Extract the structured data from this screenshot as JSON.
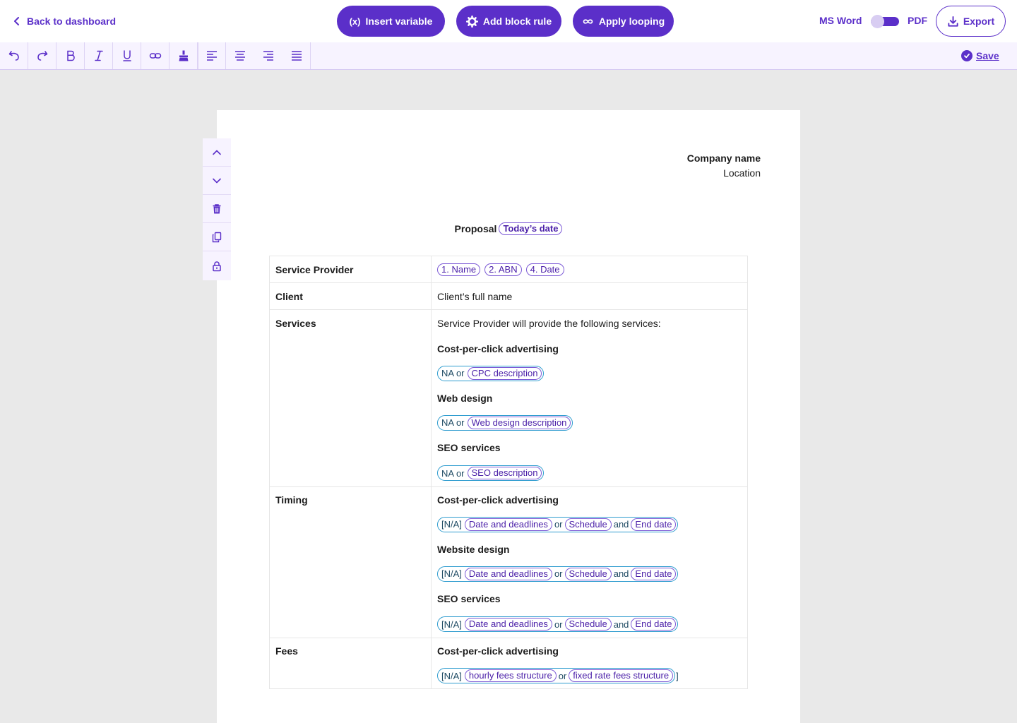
{
  "header": {
    "back_label": "Back to dashboard",
    "insert_variable_label": "Insert variable",
    "insert_variable_icon_text": "(x)",
    "add_block_rule_label": "Add block rule",
    "apply_looping_label": "Apply looping",
    "format_left": "MS Word",
    "format_right": "PDF",
    "export_label": "Export"
  },
  "toolbar": {
    "buttons": [
      "undo-icon",
      "redo-icon",
      "bold-icon",
      "italic-icon",
      "underline-icon",
      "link-icon",
      "format-painter-icon",
      "align-left-icon",
      "align-center-icon",
      "align-right-icon",
      "align-justify-icon"
    ],
    "save_label": "Save"
  },
  "side_tools": [
    "move-up-icon",
    "move-down-icon",
    "delete-icon",
    "copy-icon",
    "lock-icon"
  ],
  "document": {
    "company_name": "Company name",
    "location": "Location",
    "title": "Proposal",
    "title_chip": "Today’s date",
    "rows": {
      "service_provider": {
        "label": "Service Provider",
        "chips": [
          "1. Name",
          "2. ABN",
          "4. Date"
        ]
      },
      "client": {
        "label": "Client",
        "value": "Client’s full name"
      },
      "services": {
        "label": "Services",
        "intro": "Service Provider will provide the following services:",
        "items": [
          {
            "title": "Cost-per-click advertising",
            "na": "NA or",
            "chip": "CPC description"
          },
          {
            "title": "Web design",
            "na": "NA or",
            "chip": "Web design description"
          },
          {
            "title": "SEO services",
            "na": "NA or",
            "chip": "SEO description"
          }
        ]
      },
      "timing": {
        "label": "Timing",
        "items": [
          {
            "title": "Cost-per-click advertising",
            "na": "[N/A]",
            "chip1": "Date and deadlines",
            "or": "or",
            "chip2": "Schedule",
            "and": "and",
            "chip3": "End date"
          },
          {
            "title": "Website design",
            "na": "[N/A]",
            "chip1": "Date and deadlines",
            "or": "or",
            "chip2": "Schedule",
            "and": "and",
            "chip3": "End date"
          },
          {
            "title": "SEO services",
            "na": "[N/A]",
            "chip1": "Date and deadlines",
            "or": "or",
            "chip2": "Schedule",
            "and": "and",
            "chip3": "End date"
          }
        ]
      },
      "fees": {
        "label": "Fees",
        "title": "Cost-per-click advertising",
        "na": "[N/A]",
        "chip1": "hourly fees structure",
        "or": "or",
        "chip2": "fixed rate fees structure",
        "tail": "]"
      }
    }
  },
  "colors": {
    "accent": "#5b2fc9",
    "group_border": "#2e9ccf",
    "chip_border": "#7d5bd6",
    "canvas": "#e9e9e9"
  }
}
